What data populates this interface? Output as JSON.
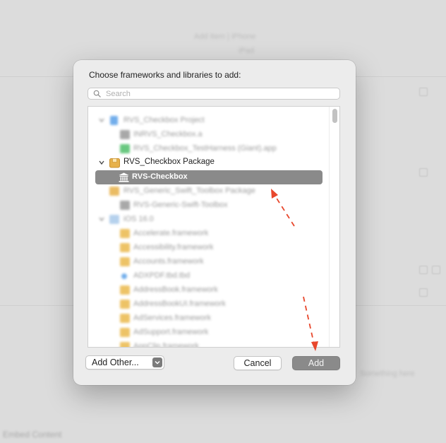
{
  "dialog": {
    "title": "Choose frameworks and libraries to add:",
    "search": {
      "placeholder": "Search",
      "value": ""
    },
    "tree": [
      {
        "label": "RVS_Checkbox Project",
        "blurred": true
      },
      {
        "label": "INRVS_Checkbox.a",
        "blurred": true
      },
      {
        "label": "RVS_Checkbox_TestHarness (Giant).app",
        "blurred": true
      },
      {
        "label": "RVS_Checkbox Package",
        "blurred": false
      },
      {
        "label": "RVS-Checkbox",
        "blurred": false,
        "selected": true
      },
      {
        "label": "RVS_Generic_Swift_Toolbox Package",
        "blurred": true
      },
      {
        "label": "RVS-Generic-Swift-Toolbox",
        "blurred": true
      },
      {
        "label": "iOS 16.0",
        "blurred": true
      },
      {
        "label": "Accelerate.framework",
        "blurred": true
      },
      {
        "label": "Accessibility.framework",
        "blurred": true
      },
      {
        "label": "Accounts.framework",
        "blurred": true
      },
      {
        "label": "ADXPDF.tbd.tbd",
        "blurred": true
      },
      {
        "label": "AddressBook.framework",
        "blurred": true
      },
      {
        "label": "AddressBookUI.framework",
        "blurred": true
      },
      {
        "label": "AdServices.framework",
        "blurred": true
      },
      {
        "label": "AdSupport.framework",
        "blurred": true
      },
      {
        "label": "AppClip.framework",
        "blurred": true
      }
    ],
    "buttons": {
      "add_other": "Add Other...",
      "cancel": "Cancel",
      "add": "Add"
    }
  },
  "background": {
    "top_line_1": "Add Item | iPhone",
    "top_line_2": "iPad",
    "bottom_left": "Embed Content",
    "right_text": "Something here"
  },
  "colors": {
    "selection": "#8a8a8a",
    "annotation_arrow": "#e8472c",
    "package_icon": "#e7b14a",
    "folder_icon": "#ebb94c"
  }
}
